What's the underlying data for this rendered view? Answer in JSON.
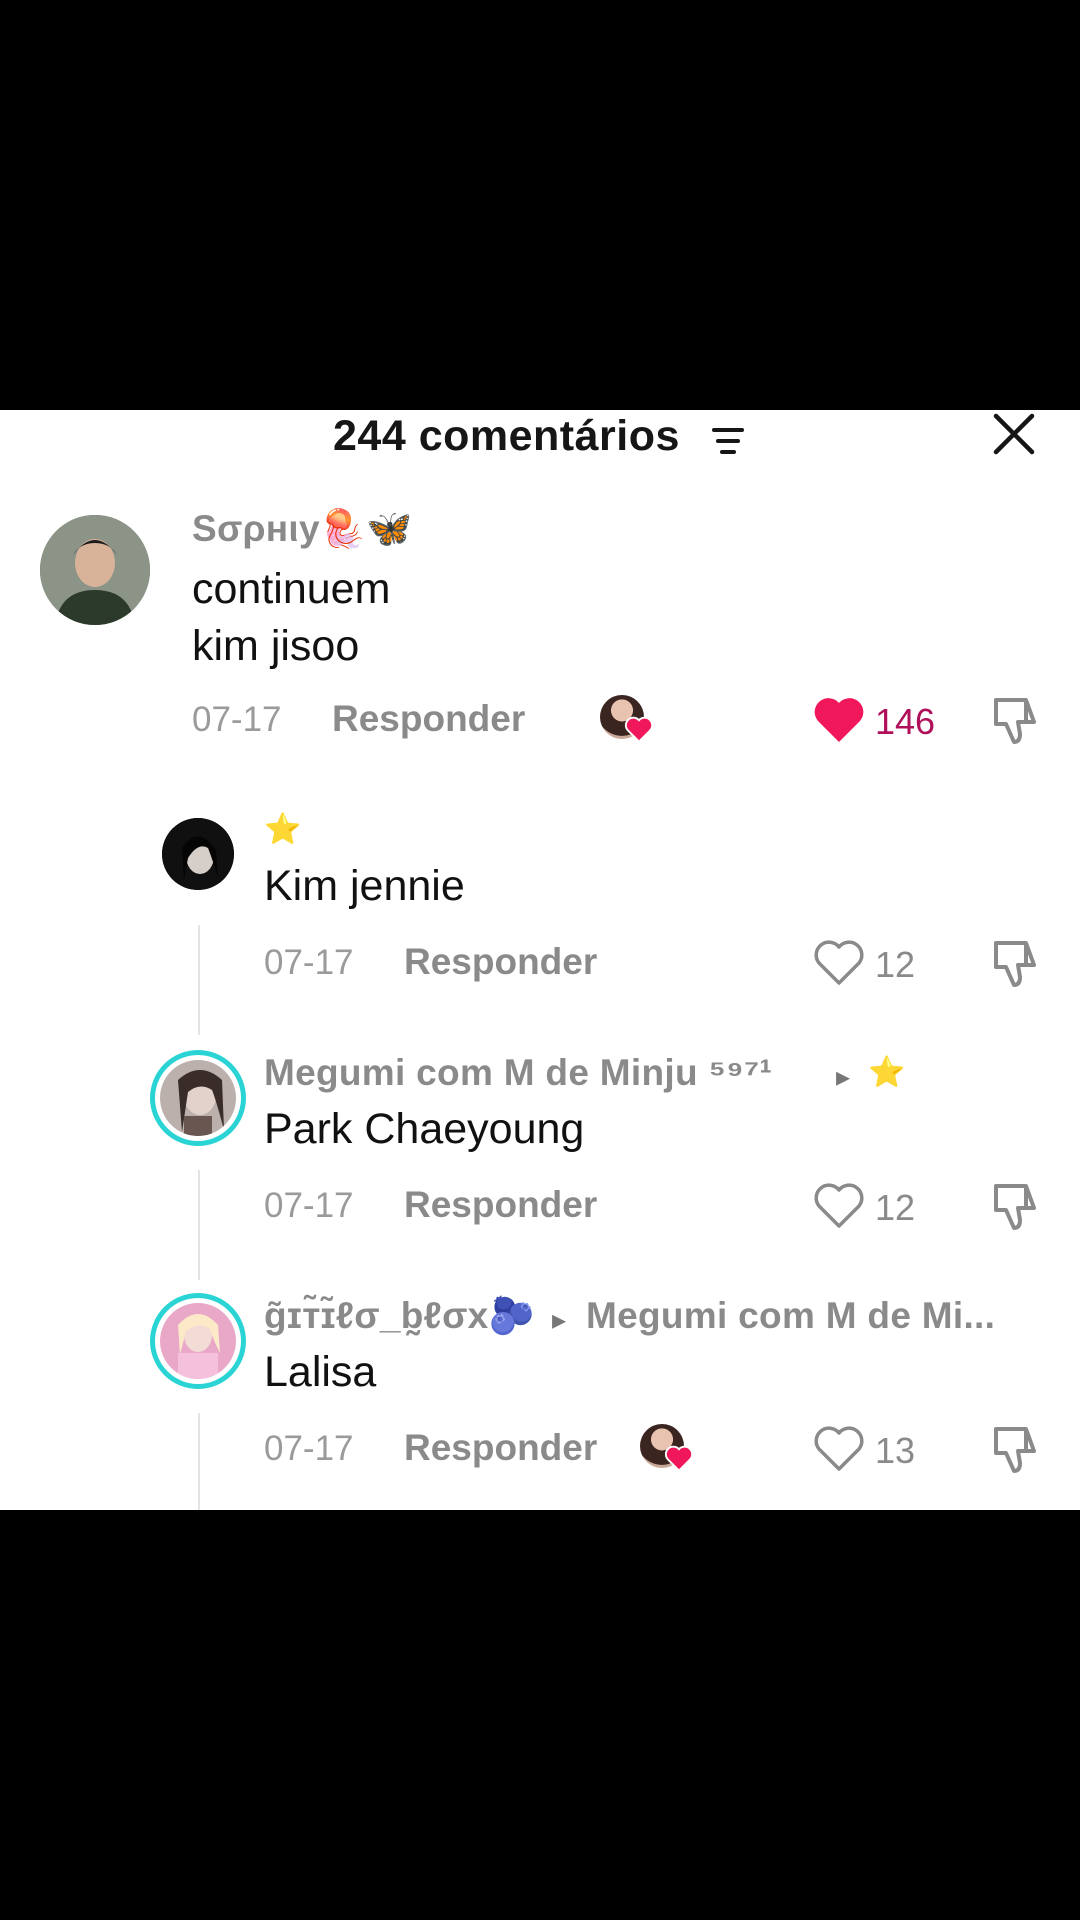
{
  "header": {
    "title": "244 comentários"
  },
  "comments": [
    {
      "username": "Sσρнιу🪼🦋",
      "text_lines": [
        "continuem",
        "kim jisoo"
      ],
      "date": "07-17",
      "reply_label": "Responder",
      "like_count": "146",
      "liked": true,
      "creator_liked": true
    },
    {
      "username": "⭐",
      "text": "Kim jennie",
      "date": "07-17",
      "reply_label": "Responder",
      "like_count": "12"
    },
    {
      "username": "Megumi com M de Minju ⁵⁹⁷¹",
      "reply_to": "⭐",
      "text": "Park Chaeyoung",
      "date": "07-17",
      "reply_label": "Responder",
      "like_count": "12"
    },
    {
      "username": "g̃ɪт̃ɪ̃ℓσ_b̰ℓσx🫐",
      "reply_to": "Megumi com M de Mi...",
      "text": "Lalisa",
      "date": "07-17",
      "reply_label": "Responder",
      "like_count": "13",
      "creator_liked": true
    }
  ],
  "colors": {
    "liked_heart": "#f0185a",
    "avatar_ring": "#2bd4d4"
  }
}
